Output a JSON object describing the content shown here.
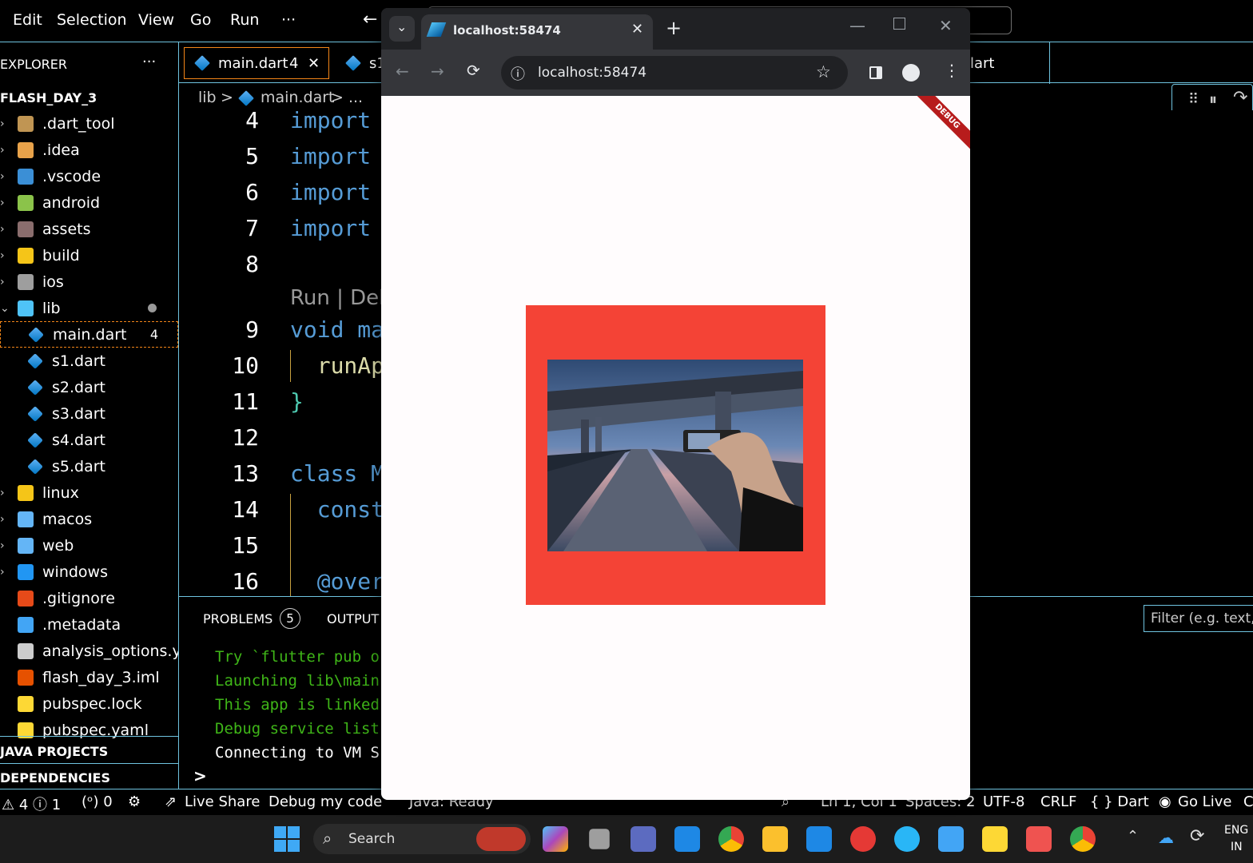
{
  "vscode": {
    "menu": [
      "Edit",
      "Selection",
      "View",
      "Go",
      "Run",
      "···"
    ],
    "back_arrow": "←",
    "sidebar": {
      "explorer_title": "EXPLORER",
      "more": "···",
      "project": "FLASH_DAY_3",
      "items": [
        {
          "label": ".dart_tool",
          "type": "folder",
          "color": "#c09553"
        },
        {
          "label": ".idea",
          "type": "folder",
          "color": "#e8a24a"
        },
        {
          "label": ".vscode",
          "type": "folder",
          "color": "#3b8fd6"
        },
        {
          "label": "android",
          "type": "folder",
          "color": "#8bc34a"
        },
        {
          "label": "assets",
          "type": "folder",
          "color": "#8a6d6d"
        },
        {
          "label": "build",
          "type": "folder",
          "color": "#f5c518"
        },
        {
          "label": "ios",
          "type": "folder",
          "color": "#9e9e9e"
        },
        {
          "label": "lib",
          "type": "folder-open",
          "color": "#4fc3f7"
        },
        {
          "label": "main.dart",
          "type": "dart",
          "badge": "4"
        },
        {
          "label": "s1.dart",
          "type": "dart"
        },
        {
          "label": "s2.dart",
          "type": "dart"
        },
        {
          "label": "s3.dart",
          "type": "dart"
        },
        {
          "label": "s4.dart",
          "type": "dart"
        },
        {
          "label": "s5.dart",
          "type": "dart"
        },
        {
          "label": "linux",
          "type": "folder",
          "color": "#f5c518"
        },
        {
          "label": "macos",
          "type": "folder",
          "color": "#64b5f6"
        },
        {
          "label": "web",
          "type": "folder",
          "color": "#64b5f6"
        },
        {
          "label": "windows",
          "type": "folder",
          "color": "#2196f3"
        },
        {
          "label": ".gitignore",
          "type": "file",
          "color": "#e64a19"
        },
        {
          "label": ".metadata",
          "type": "file",
          "color": "#42a5f5"
        },
        {
          "label": "analysis_options.y...",
          "type": "file",
          "color": "#ccc"
        },
        {
          "label": "flash_day_3.iml",
          "type": "file",
          "color": "#e65100"
        },
        {
          "label": "pubspec.lock",
          "type": "file",
          "color": "#fdd835"
        },
        {
          "label": "pubspec.yaml",
          "type": "file",
          "color": "#fdd835"
        }
      ],
      "java_projects": "JAVA PROJECTS",
      "dependencies": "DEPENDENCIES"
    },
    "tabs": {
      "main": "main.dart",
      "main_badge": "4",
      "close": "✕",
      "second": "s1",
      "third": "lart"
    },
    "breadcrumb": {
      "lib": "lib",
      "sep": ">",
      "file": "main.dart",
      "rest": "> ..."
    },
    "editor": {
      "lines": [
        {
          "n": "4",
          "code": "import",
          "cls": "kw"
        },
        {
          "n": "5",
          "code": "import",
          "cls": "kw"
        },
        {
          "n": "6",
          "code": "import",
          "cls": "kw"
        },
        {
          "n": "7",
          "code": "import",
          "cls": "kw"
        },
        {
          "n": "8",
          "code": "",
          "cls": ""
        },
        {
          "n": "9",
          "code": "void ma",
          "cls": "mix9"
        },
        {
          "n": "10",
          "code": "  runAp",
          "cls": "fn"
        },
        {
          "n": "11",
          "code": "}",
          "cls": "ty"
        },
        {
          "n": "12",
          "code": "",
          "cls": ""
        },
        {
          "n": "13",
          "code": "class M",
          "cls": "mix13"
        },
        {
          "n": "14",
          "code": "  const",
          "cls": "kw"
        },
        {
          "n": "15",
          "code": "",
          "cls": ""
        },
        {
          "n": "16",
          "code": "  @over",
          "cls": "kw"
        }
      ],
      "codelens": "Run | Deb"
    },
    "panel": {
      "problems": "PROBLEMS",
      "problems_count": "5",
      "output": "OUTPUT",
      "filter_placeholder": "Filter (e.g. text, !",
      "terminal": [
        {
          "text": "Try `flutter pub o",
          "color": "#3fb618"
        },
        {
          "text": "Launching lib\\main",
          "color": "#3fb618"
        },
        {
          "text": "This app is linked",
          "color": "#3fb618"
        },
        {
          "text": "Debug service list",
          "color": "#3fb618"
        },
        {
          "text": "Connecting to VM S",
          "color": "#ffffff"
        }
      ],
      "prompt": ">"
    },
    "status": {
      "problems": "⚠ 4 ⓘ 1",
      "ports": "(ᵒ) 0",
      "live_share": "Live Share",
      "debug": "Debug my code",
      "java": "Java: Ready",
      "position": "Ln 1, Col 1",
      "spaces": "Spaces: 2",
      "encoding": "UTF-8",
      "eol": "CRLF",
      "language": "{ } Dart",
      "golive": "Go Live",
      "extra": "C"
    }
  },
  "browser": {
    "tab_title": "localhost:58474",
    "url": "localhost:58474",
    "debug_banner": "DEBUG",
    "page_bg": "#fffcfd",
    "box_color": "#f44336"
  },
  "taskbar": {
    "search": "Search",
    "lang": "ENG",
    "region": "IN",
    "icons": [
      "copilot-icon",
      "task-view-icon",
      "teams-icon",
      "mail-icon",
      "chrome-icon",
      "file-explorer-icon",
      "vscode-icon",
      "wps-icon",
      "telegram-icon",
      "store-icon",
      "sticky-notes-icon",
      "snipping-tool-icon",
      "chrome-icon-2"
    ]
  }
}
